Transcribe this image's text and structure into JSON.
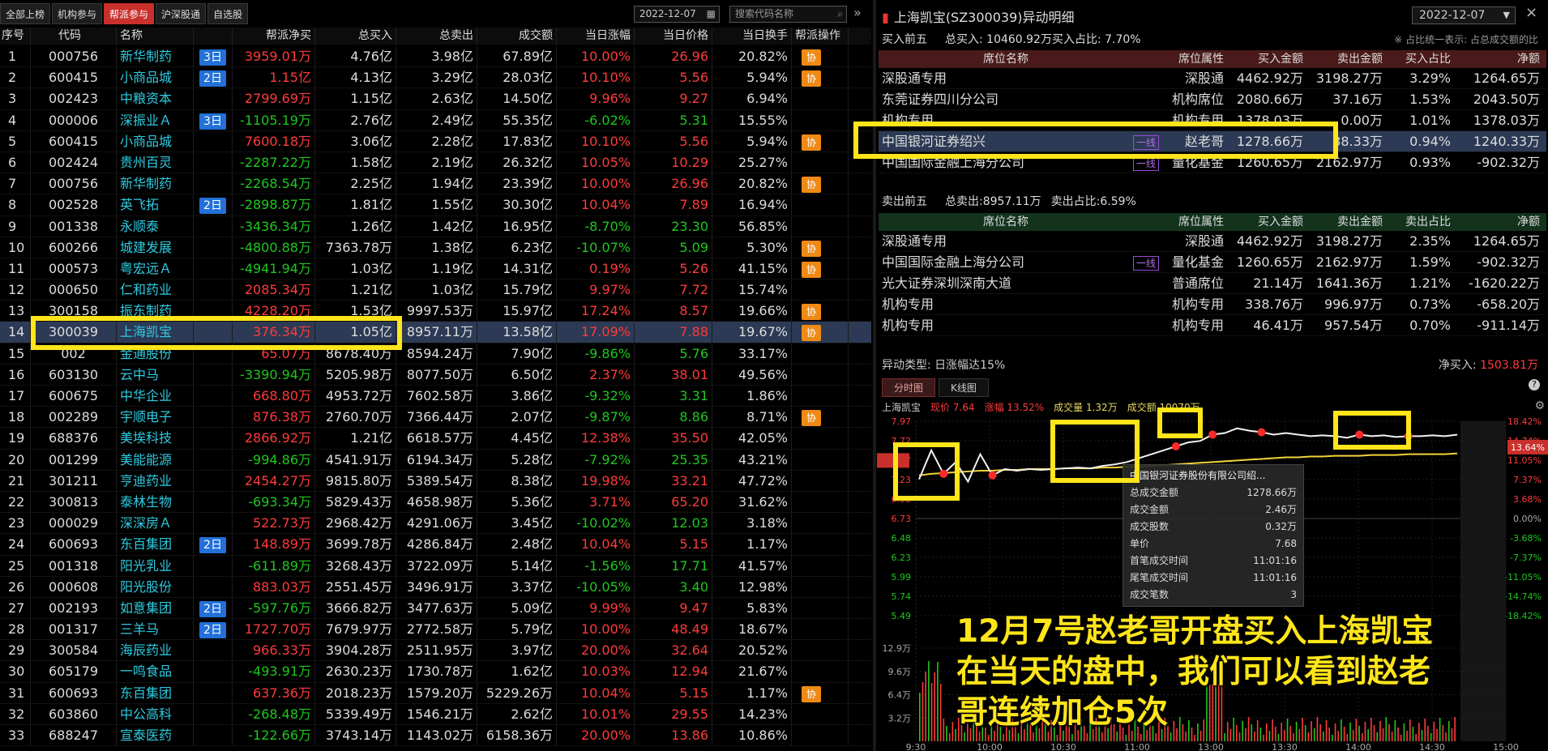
{
  "left": {
    "tabs": [
      "全部上榜",
      "机构参与",
      "帮派参与",
      "沪深股通",
      "自选股"
    ],
    "active_tab": 2,
    "date": "2022-12-07",
    "search_placeholder": "搜索代码名称",
    "headers": [
      "序号",
      "代码",
      "名称",
      "",
      "帮派净买",
      "总买入",
      "总卖出",
      "成交额",
      "当日涨幅",
      "当日价格",
      "当日换手",
      "帮派操作"
    ],
    "xie_label": "协",
    "rows": [
      {
        "idx": "1",
        "code": "000756",
        "name": "新华制药",
        "badge": "3日",
        "net": "3959.01万",
        "buy": "4.76亿",
        "sell": "3.98亿",
        "vol": "67.89亿",
        "pct": "10.00%",
        "price": "26.96",
        "turn": "20.82%",
        "xie": true
      },
      {
        "idx": "2",
        "code": "600415",
        "name": "小商品城",
        "badge": "2日",
        "net": "1.15亿",
        "buy": "4.13亿",
        "sell": "3.29亿",
        "vol": "28.03亿",
        "pct": "10.10%",
        "price": "5.56",
        "turn": "5.94%",
        "xie": true
      },
      {
        "idx": "3",
        "code": "002423",
        "name": "中粮资本",
        "badge": "",
        "net": "2799.69万",
        "buy": "1.15亿",
        "sell": "2.63亿",
        "vol": "14.50亿",
        "pct": "9.96%",
        "price": "9.27",
        "turn": "6.94%",
        "xie": false
      },
      {
        "idx": "4",
        "code": "000006",
        "name": "深振业Ａ",
        "badge": "3日",
        "net": "-1105.19万",
        "buy": "2.76亿",
        "sell": "2.49亿",
        "vol": "55.35亿",
        "pct": "-6.02%",
        "price": "5.31",
        "turn": "15.55%",
        "xie": false
      },
      {
        "idx": "5",
        "code": "600415",
        "name": "小商品城",
        "badge": "",
        "net": "7600.18万",
        "buy": "3.06亿",
        "sell": "2.28亿",
        "vol": "17.83亿",
        "pct": "10.10%",
        "price": "5.56",
        "turn": "5.94%",
        "xie": true
      },
      {
        "idx": "6",
        "code": "002424",
        "name": "贵州百灵",
        "badge": "",
        "net": "-2287.22万",
        "buy": "1.58亿",
        "sell": "2.19亿",
        "vol": "26.32亿",
        "pct": "10.05%",
        "price": "10.29",
        "turn": "25.27%",
        "xie": false
      },
      {
        "idx": "7",
        "code": "000756",
        "name": "新华制药",
        "badge": "",
        "net": "-2268.54万",
        "buy": "2.25亿",
        "sell": "1.94亿",
        "vol": "23.39亿",
        "pct": "10.00%",
        "price": "26.96",
        "turn": "20.82%",
        "xie": true
      },
      {
        "idx": "8",
        "code": "002528",
        "name": "英飞拓",
        "badge": "2日",
        "net": "-2898.87万",
        "buy": "1.81亿",
        "sell": "1.55亿",
        "vol": "30.30亿",
        "pct": "10.04%",
        "price": "7.89",
        "turn": "16.94%",
        "xie": false
      },
      {
        "idx": "9",
        "code": "001338",
        "name": "永顺泰",
        "badge": "",
        "net": "-3436.34万",
        "buy": "1.26亿",
        "sell": "1.42亿",
        "vol": "16.95亿",
        "pct": "-8.70%",
        "price": "23.30",
        "turn": "56.85%",
        "xie": false
      },
      {
        "idx": "10",
        "code": "600266",
        "name": "城建发展",
        "badge": "",
        "net": "-4800.88万",
        "buy": "7363.78万",
        "sell": "1.38亿",
        "vol": "6.23亿",
        "pct": "-10.07%",
        "price": "5.09",
        "turn": "5.30%",
        "xie": true
      },
      {
        "idx": "11",
        "code": "000573",
        "name": "粤宏远Ａ",
        "badge": "",
        "net": "-4941.94万",
        "buy": "1.03亿",
        "sell": "1.19亿",
        "vol": "14.31亿",
        "pct": "0.19%",
        "price": "5.26",
        "turn": "41.15%",
        "xie": true
      },
      {
        "idx": "12",
        "code": "000650",
        "name": "仁和药业",
        "badge": "",
        "net": "2085.34万",
        "buy": "1.21亿",
        "sell": "1.03亿",
        "vol": "15.79亿",
        "pct": "9.97%",
        "price": "7.72",
        "turn": "15.74%",
        "xie": false
      },
      {
        "idx": "13",
        "code": "300158",
        "name": "振东制药",
        "badge": "",
        "net": "4228.20万",
        "buy": "1.53亿",
        "sell": "9997.53万",
        "vol": "15.97亿",
        "pct": "17.24%",
        "price": "8.57",
        "turn": "19.66%",
        "xie": true
      },
      {
        "idx": "14",
        "code": "300039",
        "name": "上海凯宝",
        "badge": "",
        "net": "376.34万",
        "buy": "1.05亿",
        "sell": "8957.11万",
        "vol": "13.58亿",
        "pct": "17.09%",
        "price": "7.88",
        "turn": "19.67%",
        "xie": true
      },
      {
        "idx": "15",
        "code": "002",
        "name": "金通股份",
        "badge": "",
        "net": "65.07万",
        "buy": "8678.40万",
        "sell": "8594.24万",
        "vol": "7.90亿",
        "pct": "-9.86%",
        "price": "5.76",
        "turn": "33.17%",
        "xie": false
      },
      {
        "idx": "16",
        "code": "603130",
        "name": "云中马",
        "badge": "",
        "net": "-3390.94万",
        "buy": "5205.98万",
        "sell": "8077.50万",
        "vol": "6.50亿",
        "pct": "2.37%",
        "price": "38.01",
        "turn": "49.56%",
        "xie": false
      },
      {
        "idx": "17",
        "code": "600675",
        "name": "中华企业",
        "badge": "",
        "net": "668.80万",
        "buy": "4953.72万",
        "sell": "7602.58万",
        "vol": "3.86亿",
        "pct": "-9.32%",
        "price": "3.31",
        "turn": "1.86%",
        "xie": false
      },
      {
        "idx": "18",
        "code": "002289",
        "name": "宇顺电子",
        "badge": "",
        "net": "876.38万",
        "buy": "2760.70万",
        "sell": "7366.44万",
        "vol": "2.07亿",
        "pct": "-9.87%",
        "price": "8.86",
        "turn": "8.71%",
        "xie": true
      },
      {
        "idx": "19",
        "code": "688376",
        "name": "美埃科技",
        "badge": "",
        "net": "2866.92万",
        "buy": "1.21亿",
        "sell": "6618.57万",
        "vol": "4.45亿",
        "pct": "12.38%",
        "price": "35.50",
        "turn": "42.05%",
        "xie": false
      },
      {
        "idx": "20",
        "code": "001299",
        "name": "美能能源",
        "badge": "",
        "net": "-994.86万",
        "buy": "4541.91万",
        "sell": "6194.34万",
        "vol": "5.28亿",
        "pct": "-7.92%",
        "price": "25.35",
        "turn": "43.21%",
        "xie": false
      },
      {
        "idx": "21",
        "code": "301211",
        "name": "亨迪药业",
        "badge": "",
        "net": "2454.27万",
        "buy": "9815.80万",
        "sell": "5389.54万",
        "vol": "8.38亿",
        "pct": "19.98%",
        "price": "33.21",
        "turn": "47.72%",
        "xie": false
      },
      {
        "idx": "22",
        "code": "300813",
        "name": "泰林生物",
        "badge": "",
        "net": "-693.34万",
        "buy": "5829.43万",
        "sell": "4658.98万",
        "vol": "5.36亿",
        "pct": "3.71%",
        "price": "65.20",
        "turn": "31.62%",
        "xie": false
      },
      {
        "idx": "23",
        "code": "000029",
        "name": "深深房Ａ",
        "badge": "",
        "net": "522.73万",
        "buy": "2968.42万",
        "sell": "4291.06万",
        "vol": "3.45亿",
        "pct": "-10.02%",
        "price": "12.03",
        "turn": "3.18%",
        "xie": false
      },
      {
        "idx": "24",
        "code": "600693",
        "name": "东百集团",
        "badge": "2日",
        "net": "148.89万",
        "buy": "3699.78万",
        "sell": "4286.84万",
        "vol": "2.48亿",
        "pct": "10.04%",
        "price": "5.15",
        "turn": "1.17%",
        "xie": false
      },
      {
        "idx": "25",
        "code": "001318",
        "name": "阳光乳业",
        "badge": "",
        "net": "-611.89万",
        "buy": "3268.43万",
        "sell": "3722.09万",
        "vol": "5.14亿",
        "pct": "-1.56%",
        "price": "17.71",
        "turn": "41.57%",
        "xie": false
      },
      {
        "idx": "26",
        "code": "000608",
        "name": "阳光股份",
        "badge": "",
        "net": "883.03万",
        "buy": "2551.45万",
        "sell": "3496.91万",
        "vol": "3.37亿",
        "pct": "-10.05%",
        "price": "3.40",
        "turn": "12.98%",
        "xie": false
      },
      {
        "idx": "27",
        "code": "002193",
        "name": "如意集团",
        "badge": "2日",
        "net": "-597.76万",
        "buy": "3666.82万",
        "sell": "3477.63万",
        "vol": "5.09亿",
        "pct": "9.99%",
        "price": "9.47",
        "turn": "5.83%",
        "xie": false
      },
      {
        "idx": "28",
        "code": "001317",
        "name": "三羊马",
        "badge": "2日",
        "net": "1727.70万",
        "buy": "7679.97万",
        "sell": "2772.58万",
        "vol": "5.79亿",
        "pct": "10.00%",
        "price": "48.49",
        "turn": "18.67%",
        "xie": false
      },
      {
        "idx": "29",
        "code": "300584",
        "name": "海辰药业",
        "badge": "",
        "net": "966.33万",
        "buy": "3904.28万",
        "sell": "2511.95万",
        "vol": "3.97亿",
        "pct": "20.00%",
        "price": "32.64",
        "turn": "20.52%",
        "xie": false
      },
      {
        "idx": "30",
        "code": "605179",
        "name": "一鸣食品",
        "badge": "",
        "net": "-493.91万",
        "buy": "2630.23万",
        "sell": "1730.78万",
        "vol": "1.62亿",
        "pct": "10.03%",
        "price": "12.94",
        "turn": "21.67%",
        "xie": false
      },
      {
        "idx": "31",
        "code": "600693",
        "name": "东百集团",
        "badge": "",
        "net": "637.36万",
        "buy": "2018.23万",
        "sell": "1579.20万",
        "vol": "5229.26万",
        "pct": "10.04%",
        "price": "5.15",
        "turn": "1.17%",
        "xie": true
      },
      {
        "idx": "32",
        "code": "603860",
        "name": "中公高科",
        "badge": "",
        "net": "-268.48万",
        "buy": "5339.49万",
        "sell": "1546.21万",
        "vol": "2.62亿",
        "pct": "10.01%",
        "price": "29.55",
        "turn": "14.23%",
        "xie": false
      },
      {
        "idx": "33",
        "code": "688247",
        "name": "宣泰医药",
        "badge": "",
        "net": "-122.66万",
        "buy": "3743.14万",
        "sell": "1143.02万",
        "vol": "6158.36万",
        "pct": "20.00%",
        "price": "13.86",
        "turn": "10.86%",
        "xie": false
      }
    ]
  },
  "right": {
    "title": "上海凯宝(SZ300039)异动明细",
    "date": "2022-12-07",
    "buy_label": "买入前五",
    "buy_total": "总买入: 10460.92万买入占比: 7.70%",
    "note": "※ 占比统一表示: 占总成交额的比",
    "buy_headers": [
      "席位名称",
      "席位属性",
      "买入金额",
      "卖出金额",
      "买入占比",
      "净额"
    ],
    "buy_rows": [
      {
        "name": "深股通专用",
        "tag": "",
        "attr": "深股通",
        "buy": "4462.92万",
        "sell": "3198.27万",
        "ratio": "3.29%",
        "net": "1264.65万"
      },
      {
        "name": "东莞证券四川分公司",
        "tag": "",
        "attr": "机构席位",
        "buy": "2080.66万",
        "sell": "37.16万",
        "ratio": "1.53%",
        "net": "2043.50万"
      },
      {
        "name": "机构专用",
        "tag": "",
        "attr": "机构专用",
        "buy": "1378.03万",
        "sell": "0.00万",
        "ratio": "1.01%",
        "net": "1378.03万"
      },
      {
        "name": "中国银河证券绍兴",
        "tag": "一线",
        "attr": "赵老哥",
        "buy": "1278.66万",
        "sell": "38.33万",
        "ratio": "0.94%",
        "net": "1240.33万"
      },
      {
        "name": "中国国际金融上海分公司",
        "tag": "一线",
        "attr": "量化基金",
        "buy": "1260.65万",
        "sell": "2162.97万",
        "ratio": "0.93%",
        "net": "-902.32万"
      }
    ],
    "sell_label": "卖出前五",
    "sell_total": "总卖出:8957.11万",
    "sell_ratio": "卖出占比:6.59%",
    "sell_headers": [
      "席位名称",
      "席位属性",
      "买入金额",
      "卖出金额",
      "卖出占比",
      "净额"
    ],
    "sell_rows": [
      {
        "name": "深股通专用",
        "tag": "",
        "attr": "深股通",
        "buy": "4462.92万",
        "sell": "3198.27万",
        "ratio": "2.35%",
        "net": "1264.65万"
      },
      {
        "name": "中国国际金融上海分公司",
        "tag": "一线",
        "attr": "量化基金",
        "buy": "1260.65万",
        "sell": "2162.97万",
        "ratio": "1.59%",
        "net": "-902.32万"
      },
      {
        "name": "光大证券深圳深南大道",
        "tag": "",
        "attr": "普通席位",
        "buy": "21.14万",
        "sell": "1641.36万",
        "ratio": "1.21%",
        "net": "-1620.22万"
      },
      {
        "name": "机构专用",
        "tag": "",
        "attr": "机构专用",
        "buy": "338.76万",
        "sell": "996.97万",
        "ratio": "0.73%",
        "net": "-658.20万"
      },
      {
        "name": "机构专用",
        "tag": "",
        "attr": "机构专用",
        "buy": "46.41万",
        "sell": "957.54万",
        "ratio": "0.70%",
        "net": "-911.14万"
      }
    ],
    "anomaly": "异动类型: 日涨幅达15%",
    "netbuy_label": "净买入:",
    "netbuy_value": "1503.81万",
    "chart_tabs": [
      "分时图",
      "K线图"
    ],
    "chart_title": {
      "name": "上海凯宝",
      "price": "现价 7.64",
      "change": "涨幅 13.52%",
      "volume": "成交量 1.32万",
      "amount": "成交额 10070万"
    },
    "tooltip": {
      "title": "中国银河证券股份有限公司绍...",
      "rows": [
        {
          "k": "总成交金额",
          "v": "1278.66万"
        },
        {
          "k": "成交金额",
          "v": "2.46万"
        },
        {
          "k": "成交股数",
          "v": "0.32万"
        },
        {
          "k": "单价",
          "v": "7.68"
        },
        {
          "k": "首笔成交时间",
          "v": "11:01:16"
        },
        {
          "k": "尾笔成交时间",
          "v": "11:01:16"
        },
        {
          "k": "成交笔数",
          "v": "3"
        }
      ]
    },
    "current_pct_label": "13.64%"
  },
  "caption": {
    "line1": "12月7号赵老哥开盘买入上海凯宝",
    "line2": "在当天的盘中，我们可以看到赵老",
    "line3": "哥连续加仓5次"
  },
  "chart_data": {
    "type": "line",
    "title": "",
    "x_ticks": [
      "9:30",
      "10:00",
      "10:30",
      "11:00",
      "13:00",
      "13:30",
      "14:00",
      "14:30",
      "15:00"
    ],
    "y_left_ticks": [
      "7.97",
      "7.72",
      "7.47",
      "7.23",
      "6.98",
      "6.73",
      "6.48",
      "6.23",
      "5.99",
      "5.74",
      "5.49"
    ],
    "y_right_ticks": [
      "18.42%",
      "14.74%",
      "11.05%",
      "7.37%",
      "3.68%",
      "0.00%",
      "-3.68%",
      "-7.37%",
      "-11.05%",
      "-14.74%",
      "-18.42%"
    ],
    "vol_ticks": [
      "12.9万",
      "9.6万",
      "6.4万",
      "3.2万"
    ],
    "ylim": [
      5.49,
      7.97
    ],
    "prev_close": 6.73,
    "price": [
      7.23,
      7.6,
      7.3,
      7.45,
      7.2,
      7.55,
      7.28,
      7.36,
      7.34,
      7.36,
      7.35,
      7.36,
      7.37,
      7.38,
      7.37,
      7.4,
      7.42,
      7.45,
      7.5,
      7.55,
      7.6,
      7.65,
      7.7,
      7.72,
      7.8,
      7.82,
      7.88,
      7.85,
      7.83,
      7.8,
      7.82,
      7.8,
      7.78,
      7.79,
      7.78,
      7.76,
      7.8,
      7.78,
      7.79,
      7.77,
      7.78,
      7.78,
      7.79,
      7.78,
      7.8
    ],
    "avg": [
      7.28,
      7.3,
      7.31,
      7.32,
      7.33,
      7.34,
      7.34,
      7.35,
      7.35,
      7.36,
      7.36,
      7.36,
      7.37,
      7.37,
      7.37,
      7.38,
      7.38,
      7.39,
      7.39,
      7.4,
      7.41,
      7.42,
      7.43,
      7.44,
      7.45,
      7.46,
      7.47,
      7.48,
      7.49,
      7.5,
      7.51,
      7.51,
      7.52,
      7.52,
      7.53,
      7.53,
      7.53,
      7.54,
      7.54,
      7.54,
      7.55,
      7.55,
      7.55,
      7.55,
      7.56
    ],
    "buy_points": [
      2,
      6,
      21,
      24,
      28,
      36,
      40
    ]
  }
}
